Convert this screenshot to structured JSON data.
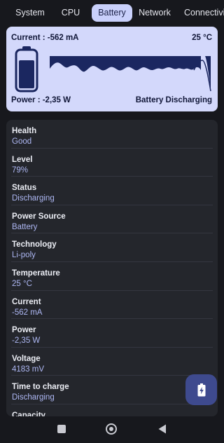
{
  "tabs": [
    {
      "label": "System"
    },
    {
      "label": "CPU"
    },
    {
      "label": "Battery"
    },
    {
      "label": "Network"
    },
    {
      "label": "Connectivity"
    }
  ],
  "summary": {
    "current": "Current : -562 mA",
    "temperature": "25 °C",
    "power": "Power : -2,35 W",
    "state": "Battery Discharging",
    "battery_level": 0.79
  },
  "details": [
    {
      "label": "Health",
      "value": "Good"
    },
    {
      "label": "Level",
      "value": "79%"
    },
    {
      "label": "Status",
      "value": "Discharging"
    },
    {
      "label": "Power Source",
      "value": "Battery"
    },
    {
      "label": "Technology",
      "value": "Li-poly"
    },
    {
      "label": "Temperature",
      "value": "25 °C"
    },
    {
      "label": "Current",
      "value": "-562 mA"
    },
    {
      "label": "Power",
      "value": "-2,35 W"
    },
    {
      "label": "Voltage",
      "value": "4183 mV"
    },
    {
      "label": "Time to charge",
      "value": "Discharging"
    },
    {
      "label": "Capacity",
      "value": ""
    }
  ],
  "icons": {
    "fab": "battery-charging-icon",
    "nav_recents": "square-icon",
    "nav_home": "circle-icon",
    "nav_back": "triangle-back-icon"
  },
  "colors": {
    "accent": "#c9d0fb",
    "card": "#d3d8fb",
    "value_text": "#aeb8f4",
    "fab": "#3e4a8e",
    "graph": "#1b2760"
  }
}
